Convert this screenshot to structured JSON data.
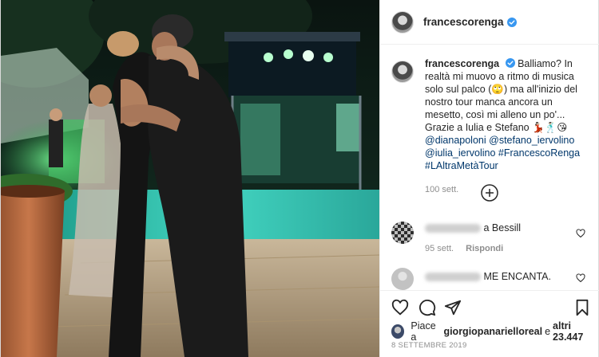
{
  "post": {
    "username": "francescorenga",
    "caption": {
      "text_1": "Balliamo? In realtà mi muovo a ritmo di musica solo sul palco (",
      "emoji_1": "🙄",
      "text_2": ") ma all'inizio del nostro tour manca ancora un mesetto, così mi alleno un po'... Grazie a Iulia e Stefano ",
      "emoji_2": "💃🏻🕺🏻😘",
      "mention_1": "@dianapoloni",
      "mention_2": "@stefano_iervolino",
      "mention_3": "@iulia_iervolino",
      "hashtag_1": "#FrancescoRenga",
      "hashtag_2": "#LAltraMetàTour",
      "time": "100 sett."
    },
    "comments": [
      {
        "name_visible": "a Bessill",
        "time": "95 sett.",
        "reply": "Rispondi"
      },
      {
        "text": "ME ENCANTA."
      }
    ],
    "likes": {
      "prefix": "Piace a ",
      "user": "giorgiopanarielloreal",
      "middle": " e ",
      "others": "altri 23.447"
    },
    "date": "8 SETTEMBRE 2019"
  },
  "icons": {
    "verified": "verified-badge-icon",
    "load_more": "plus-circle-icon",
    "like": "heart-icon",
    "comment": "comment-icon",
    "share": "paper-plane-icon",
    "save": "bookmark-icon"
  },
  "colors": {
    "verified": "#3897f0",
    "link": "#00376b",
    "meta": "#8e8e8e",
    "border": "#efefef"
  }
}
